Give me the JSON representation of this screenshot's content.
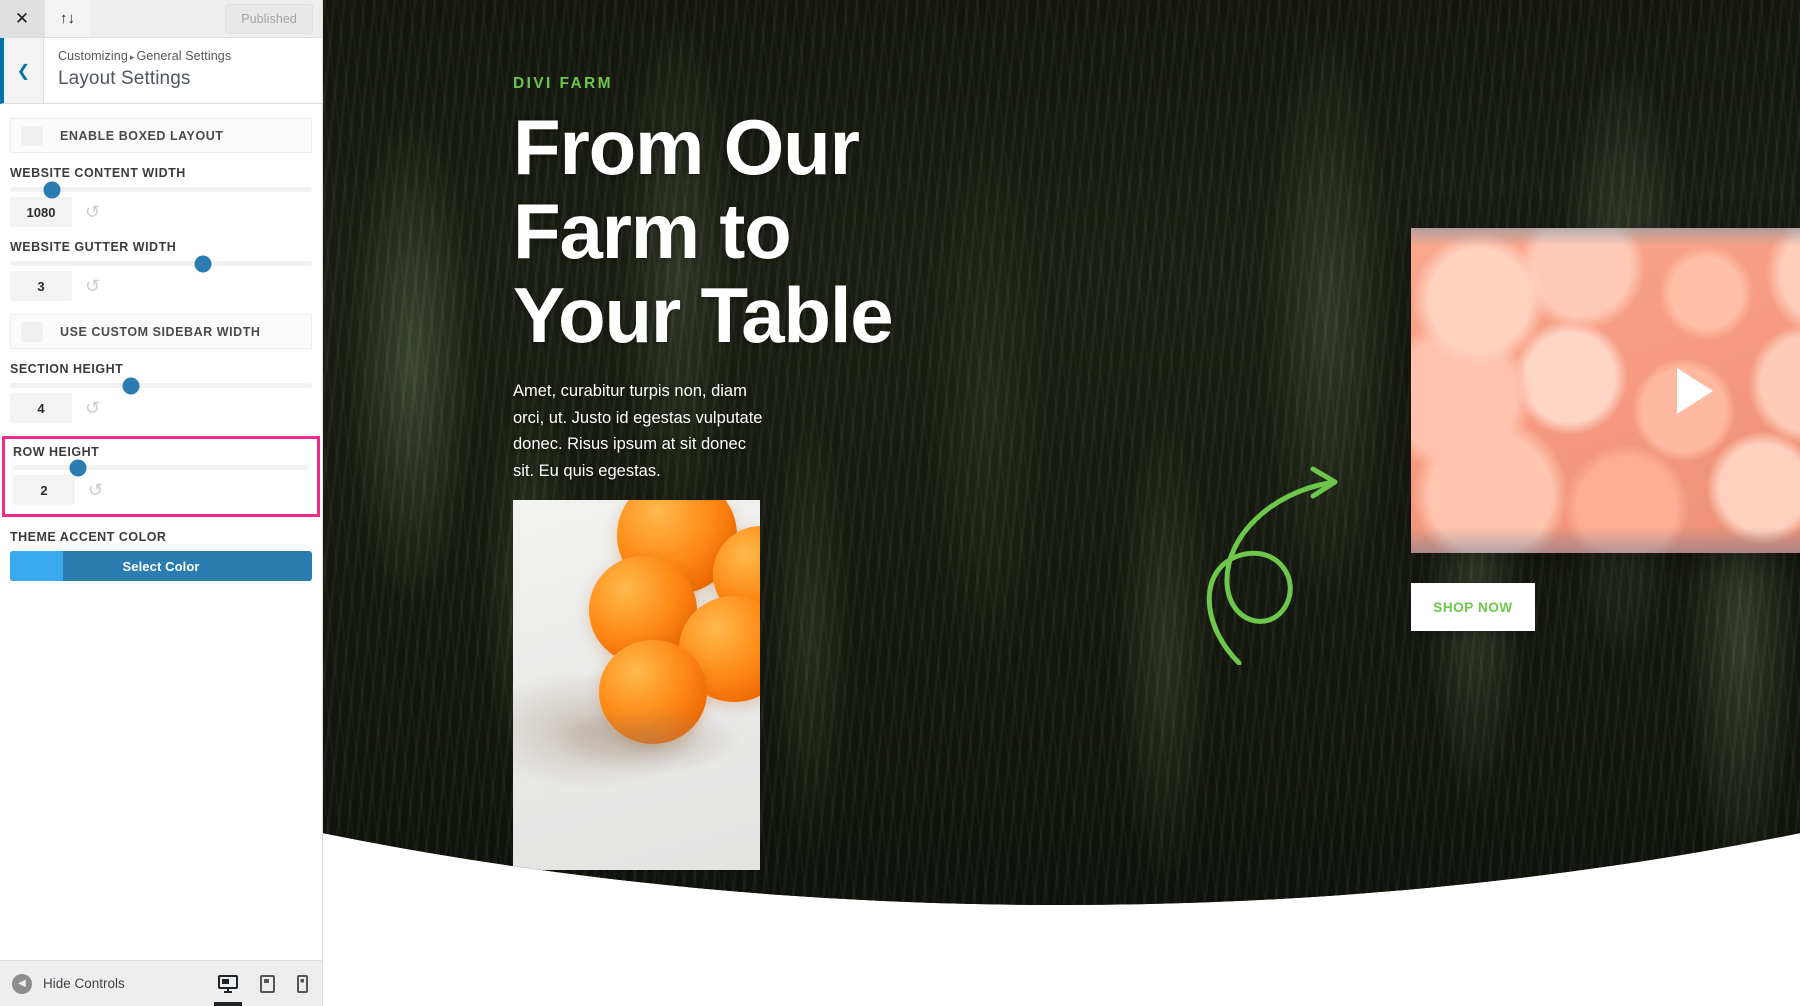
{
  "customizer": {
    "topbar": {
      "close_icon": "close-icon",
      "updown_icon": "collapse-expand-icon",
      "publish_label": "Published"
    },
    "header": {
      "back_icon": "chevron-left-icon",
      "breadcrumb_root": "Customizing",
      "breadcrumb_separator": "▸",
      "breadcrumb_parent": "General Settings",
      "title": "Layout Settings"
    },
    "controls": [
      {
        "type": "toggle",
        "label": "ENABLE BOXED LAYOUT",
        "checked": false
      },
      {
        "type": "slider",
        "label": "WEBSITE CONTENT WIDTH",
        "value": "1080",
        "knob_percent": 14
      },
      {
        "type": "slider",
        "label": "WEBSITE GUTTER WIDTH",
        "value": "3",
        "knob_percent": 64
      },
      {
        "type": "toggle",
        "label": "USE CUSTOM SIDEBAR WIDTH",
        "checked": false
      },
      {
        "type": "slider",
        "label": "SECTION HEIGHT",
        "value": "4",
        "knob_percent": 40
      },
      {
        "type": "slider",
        "label": "ROW HEIGHT",
        "value": "2",
        "knob_percent": 22,
        "highlighted": true
      },
      {
        "type": "color",
        "label": "THEME ACCENT COLOR",
        "button_label": "Select Color",
        "swatch_color": "#3ba9f0"
      }
    ],
    "highlight_color": "#ef2a87",
    "bottom": {
      "hide_controls_label": "Hide Controls",
      "hide_icon": "chevron-left-circle-icon",
      "devices": [
        {
          "name": "desktop-preview-icon",
          "active": true
        },
        {
          "name": "tablet-preview-icon",
          "active": false
        },
        {
          "name": "mobile-preview-icon",
          "active": false
        }
      ]
    }
  },
  "preview": {
    "eyebrow": "DIVI FARM",
    "heading": "From Our Farm to Your Table",
    "paragraph": "Amet, curabitur turpis non, diam orci, ut. Justo id egestas vulputate donec. Risus ipsum at sit donec sit. Eu quis egestas.",
    "shop_button": "SHOP NOW",
    "video": {
      "play_icon": "play-icon"
    },
    "decoration": {
      "arrow_icon": "curly-arrow-icon",
      "arrow_color": "#6ec64b"
    },
    "images": {
      "oranges": "oranges-photo",
      "peaches": "peaches-video-thumbnail"
    },
    "accent_green": "#6ec64b"
  }
}
